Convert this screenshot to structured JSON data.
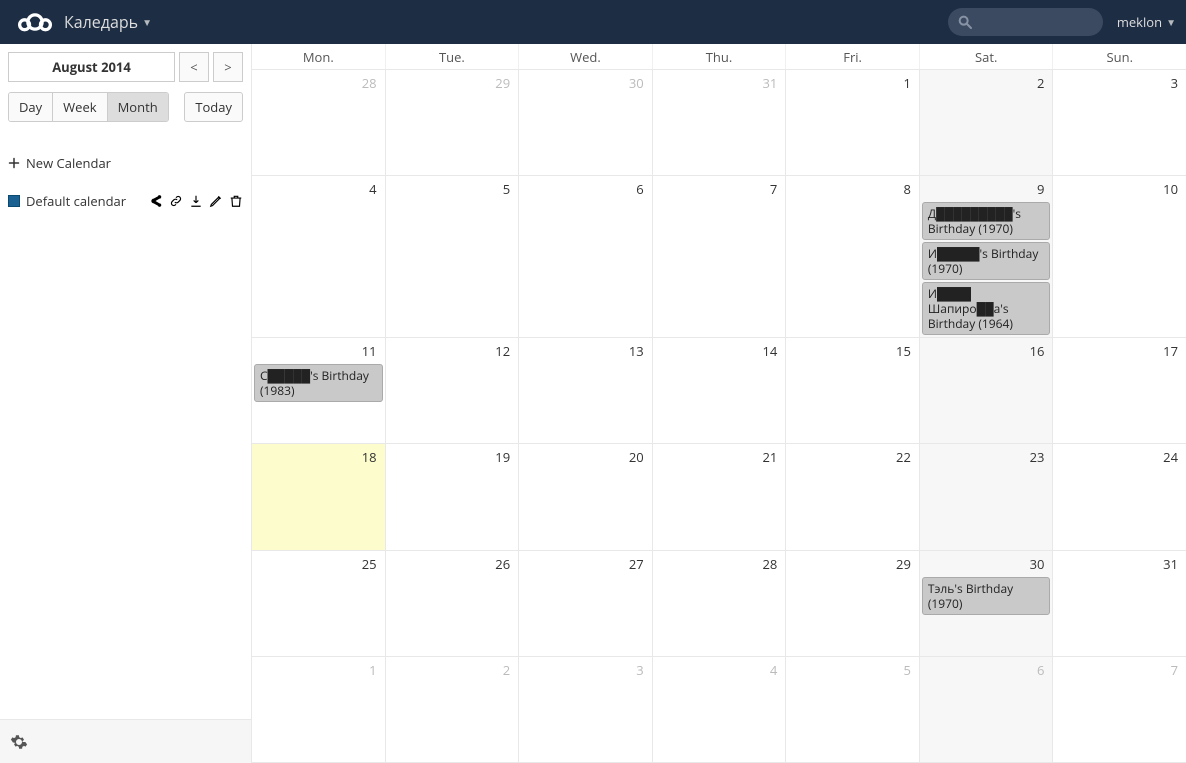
{
  "header": {
    "app_title": "Каледарь",
    "user": "meklon",
    "search_placeholder": ""
  },
  "sidebar": {
    "current_period": "August 2014",
    "prev": "<",
    "next": ">",
    "views": {
      "day": "Day",
      "week": "Week",
      "month": "Month",
      "active": "month"
    },
    "today": "Today",
    "new_calendar": "New Calendar",
    "calendars": [
      {
        "name": "Default calendar",
        "color": "#1a6091"
      }
    ]
  },
  "calendar": {
    "weekdays": [
      "Mon.",
      "Tue.",
      "Wed.",
      "Thu.",
      "Fri.",
      "Sat.",
      "Sun."
    ],
    "today_index": {
      "week": 3,
      "day": 0
    },
    "weeks": [
      {
        "days": [
          {
            "n": 28,
            "out": true
          },
          {
            "n": 29,
            "out": true
          },
          {
            "n": 30,
            "out": true
          },
          {
            "n": 31,
            "out": true
          },
          {
            "n": 1
          },
          {
            "n": 2,
            "wkend": true
          },
          {
            "n": 3
          }
        ]
      },
      {
        "days": [
          {
            "n": 4
          },
          {
            "n": 5
          },
          {
            "n": 6
          },
          {
            "n": 7
          },
          {
            "n": 8
          },
          {
            "n": 9,
            "wkend": true,
            "events": [
              {
                "title": "Д█████████'s Birthday (1970)"
              },
              {
                "title": "И█████'s Birthday (1970)"
              },
              {
                "title": "И████ Шапиро██a's Birthday (1964)"
              }
            ]
          },
          {
            "n": 10
          }
        ]
      },
      {
        "days": [
          {
            "n": 11,
            "events": [
              {
                "title": "С█████'s Birthday (1983)"
              }
            ]
          },
          {
            "n": 12
          },
          {
            "n": 13
          },
          {
            "n": 14
          },
          {
            "n": 15
          },
          {
            "n": 16,
            "wkend": true
          },
          {
            "n": 17
          }
        ]
      },
      {
        "days": [
          {
            "n": 18
          },
          {
            "n": 19
          },
          {
            "n": 20
          },
          {
            "n": 21
          },
          {
            "n": 22
          },
          {
            "n": 23,
            "wkend": true
          },
          {
            "n": 24
          }
        ]
      },
      {
        "days": [
          {
            "n": 25
          },
          {
            "n": 26
          },
          {
            "n": 27
          },
          {
            "n": 28
          },
          {
            "n": 29
          },
          {
            "n": 30,
            "wkend": true,
            "events": [
              {
                "title": "Тэль's Birthday (1970)"
              }
            ]
          },
          {
            "n": 31
          }
        ]
      },
      {
        "days": [
          {
            "n": 1,
            "out": true
          },
          {
            "n": 2,
            "out": true
          },
          {
            "n": 3,
            "out": true
          },
          {
            "n": 4,
            "out": true
          },
          {
            "n": 5,
            "out": true
          },
          {
            "n": 6,
            "out": true,
            "wkend": true
          },
          {
            "n": 7,
            "out": true
          }
        ]
      }
    ]
  }
}
